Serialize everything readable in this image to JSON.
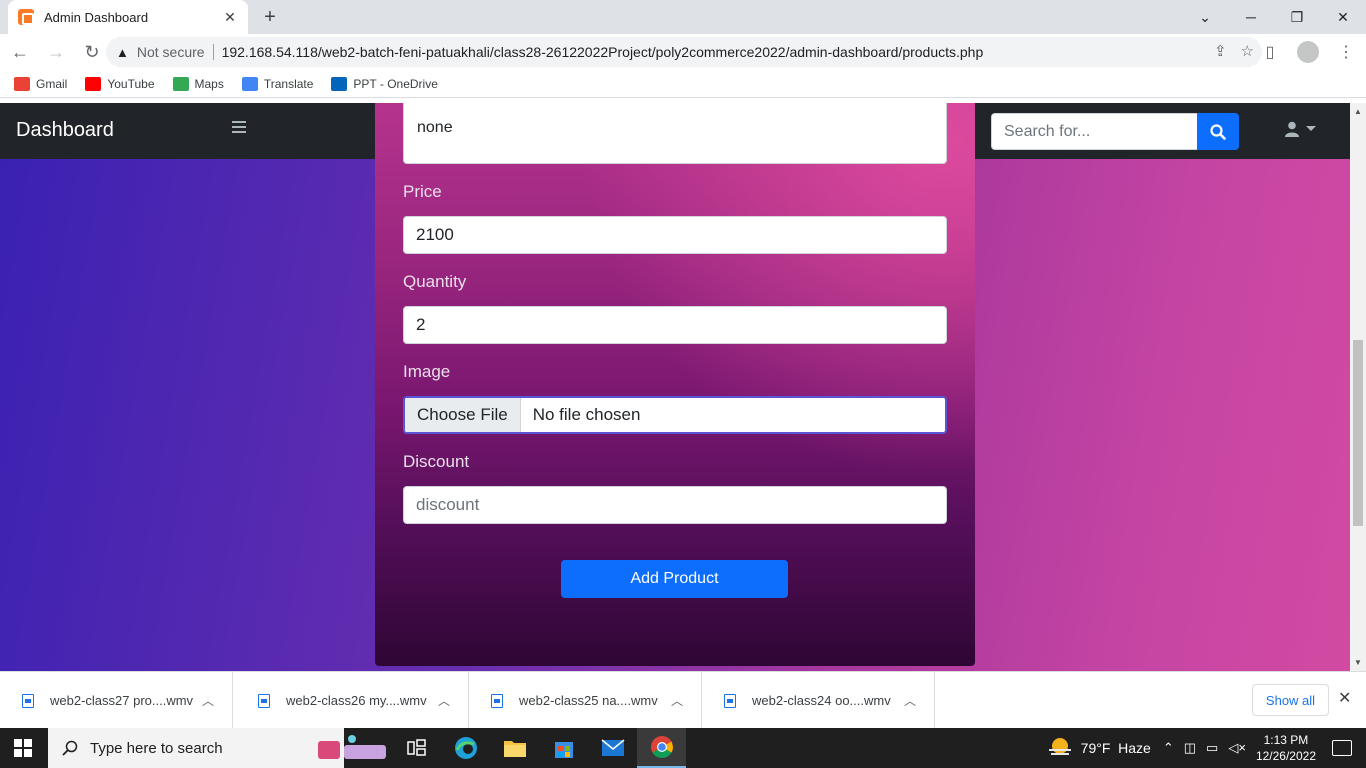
{
  "browser": {
    "tab_title": "Admin Dashboard",
    "not_secure": "Not secure",
    "url": "192.168.54.118/web2-batch-feni-patuakhali/class28-26122022Project/poly2commerce2022/admin-dashboard/products.php",
    "bookmarks": [
      {
        "label": "Gmail",
        "icon": "gmail-icon",
        "color": "#ea4335"
      },
      {
        "label": "YouTube",
        "icon": "youtube-icon",
        "color": "#ff0000"
      },
      {
        "label": "Maps",
        "icon": "maps-icon",
        "color": "#34a853"
      },
      {
        "label": "Translate",
        "icon": "translate-icon",
        "color": "#4285f4"
      },
      {
        "label": "PPT - OneDrive",
        "icon": "onedrive-icon",
        "color": "#0364b8"
      }
    ]
  },
  "navbar": {
    "brand": "Dashboard",
    "search_placeholder": "Search for..."
  },
  "form": {
    "description_value": "none",
    "price_label": "Price",
    "price_value": "2100",
    "quantity_label": "Quantity",
    "quantity_value": "2",
    "image_label": "Image",
    "choose_file": "Choose File",
    "file_status": "No file chosen",
    "discount_label": "Discount",
    "discount_placeholder": "discount",
    "submit_label": "Add Product"
  },
  "downloads": {
    "items": [
      {
        "name": "web2-class27 pro....wmv"
      },
      {
        "name": "web2-class26 my....wmv"
      },
      {
        "name": "web2-class25 na....wmv"
      },
      {
        "name": "web2-class24 oo....wmv"
      }
    ],
    "show_all": "Show all"
  },
  "taskbar": {
    "search_text": "Type here to search",
    "weather": "79°F  Haze",
    "time": "1:13 PM",
    "date": "12/26/2022"
  },
  "colors": {
    "primary": "#0d6efd",
    "navbar": "#212529"
  }
}
